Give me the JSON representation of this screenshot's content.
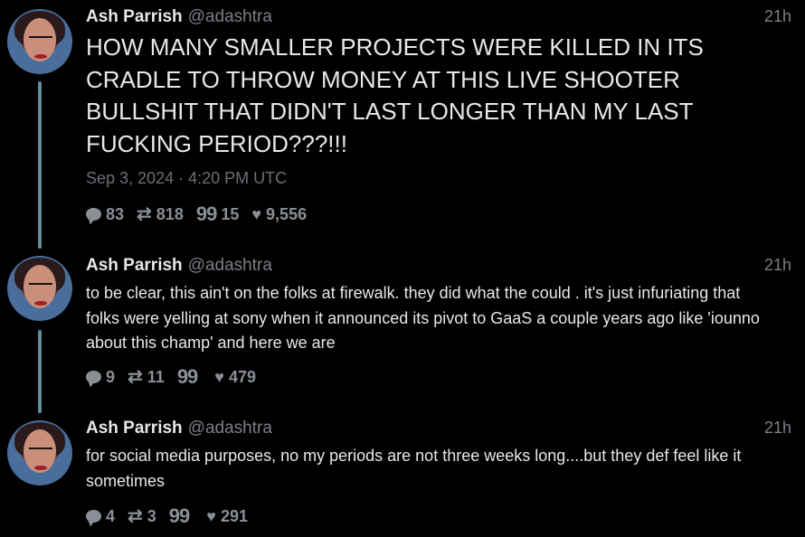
{
  "tweets": [
    {
      "name": "Ash Parrish",
      "handle": "@adashtra",
      "time": "21h",
      "text": "HOW MANY SMALLER PROJECTS WERE KILLED IN ITS CRADLE TO THROW MONEY AT THIS LIVE SHOOTER BULLSHIT THAT DIDN'T LAST LONGER THAN MY LAST FUCKING PERIOD???!!!",
      "date": "Sep 3, 2024 · 4:20 PM UTC",
      "replies": "83",
      "retweets": "818",
      "quotes": "15",
      "likes": "9,556"
    },
    {
      "name": "Ash Parrish",
      "handle": "@adashtra",
      "time": "21h",
      "text": "to be clear, this ain't on the folks at firewalk. they did what the could . it's just infuriating that folks were yelling at sony when it announced its pivot to GaaS a couple years ago like 'iounno about this champ' and here we are",
      "replies": "9",
      "retweets": "11",
      "quotes": "",
      "likes": "479"
    },
    {
      "name": "Ash Parrish",
      "handle": "@adashtra",
      "time": "21h",
      "text": "for social media purposes, no my periods are not three weeks long....but they def feel like it sometimes",
      "replies": "4",
      "retweets": "3",
      "quotes": "",
      "likes": "291"
    }
  ],
  "icons": {
    "reply": "comment-bubble-icon",
    "retweet": "retweet-icon",
    "quote": "quote-icon",
    "like": "heart-icon"
  },
  "colors": {
    "background": "#000000",
    "thread_line": "#5f8f98",
    "muted": "#7b7f86"
  }
}
